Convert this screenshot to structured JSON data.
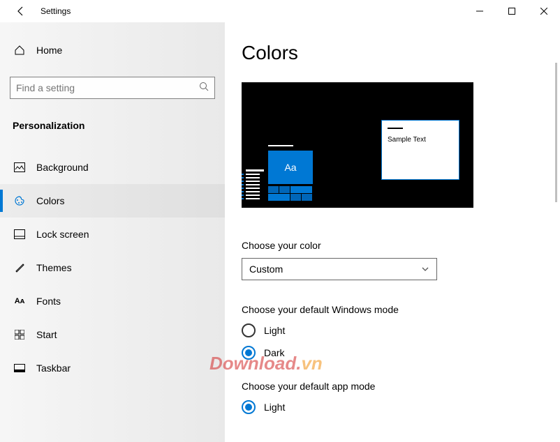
{
  "titlebar": {
    "title": "Settings"
  },
  "sidebar": {
    "home_label": "Home",
    "search_placeholder": "Find a setting",
    "category": "Personalization",
    "items": [
      {
        "label": "Background",
        "icon": "picture"
      },
      {
        "label": "Colors",
        "icon": "palette"
      },
      {
        "label": "Lock screen",
        "icon": "lockscreen"
      },
      {
        "label": "Themes",
        "icon": "brush"
      },
      {
        "label": "Fonts",
        "icon": "fonts"
      },
      {
        "label": "Start",
        "icon": "start"
      },
      {
        "label": "Taskbar",
        "icon": "taskbar"
      }
    ],
    "selected": 1
  },
  "main": {
    "page_title": "Colors",
    "preview": {
      "tile_text": "Aa",
      "sample_text": "Sample Text"
    },
    "choose_color": {
      "label": "Choose your color",
      "value": "Custom"
    },
    "windows_mode": {
      "label": "Choose your default Windows mode",
      "options": [
        "Light",
        "Dark"
      ],
      "selected": "Dark"
    },
    "app_mode": {
      "label": "Choose your default app mode",
      "options": [
        "Light"
      ],
      "selected": "Light"
    }
  },
  "watermark": {
    "main": "Download.",
    "suffix": "vn"
  },
  "colors": {
    "accent": "#0078d4"
  }
}
